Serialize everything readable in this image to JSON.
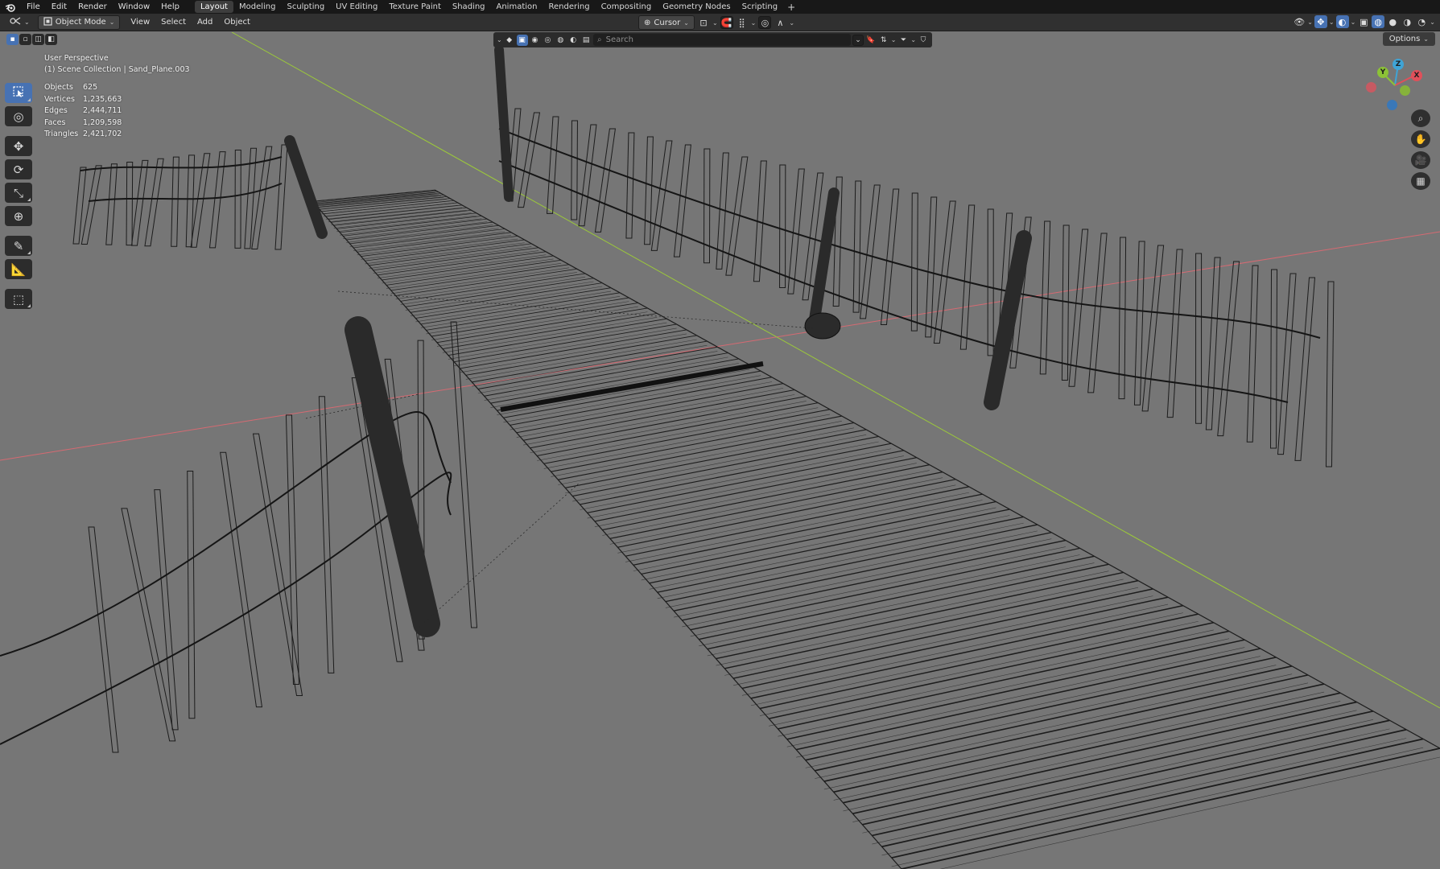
{
  "topbar": {
    "menus": [
      "File",
      "Edit",
      "Render",
      "Window",
      "Help"
    ],
    "workspaces": [
      "Layout",
      "Modeling",
      "Sculpting",
      "UV Editing",
      "Texture Paint",
      "Shading",
      "Animation",
      "Rendering",
      "Compositing",
      "Geometry Nodes",
      "Scripting"
    ],
    "active_workspace": "Layout",
    "add_label": "+"
  },
  "header": {
    "mode": "Object Mode",
    "menus": [
      "View",
      "Select",
      "Add",
      "Object"
    ],
    "pivot": "Cursor"
  },
  "search": {
    "placeholder": "Search"
  },
  "options_label": "Options",
  "overlay": {
    "view_name": "User Perspective",
    "collection": "(1) Scene Collection | Sand_Plane.003",
    "stats": [
      {
        "k": "Objects",
        "v": "625"
      },
      {
        "k": "Vertices",
        "v": "1,235,663"
      },
      {
        "k": "Edges",
        "v": "2,444,711"
      },
      {
        "k": "Faces",
        "v": "1,209,598"
      },
      {
        "k": "Triangles",
        "v": "2,421,702"
      }
    ]
  },
  "gizmo": {
    "x": "X",
    "y": "Y",
    "z": "Z"
  },
  "colors": {
    "viewport_bg": "#767676",
    "accent": "#4772b3",
    "x_axis": "#e0505a",
    "y_axis": "#8cc236",
    "z_axis": "#3fa4d6",
    "wire": "#1c1c1c"
  },
  "icons": {
    "blender_logo": "blender-logo-icon",
    "tools": [
      "select-box-icon",
      "cursor-icon",
      "move-icon",
      "rotate-icon",
      "scale-icon",
      "transform-icon",
      "annotate-icon",
      "measure-icon",
      "add-cube-icon"
    ],
    "nav": [
      "zoom-icon",
      "pan-hand-icon",
      "camera-icon",
      "grid-ortho-icon"
    ]
  }
}
